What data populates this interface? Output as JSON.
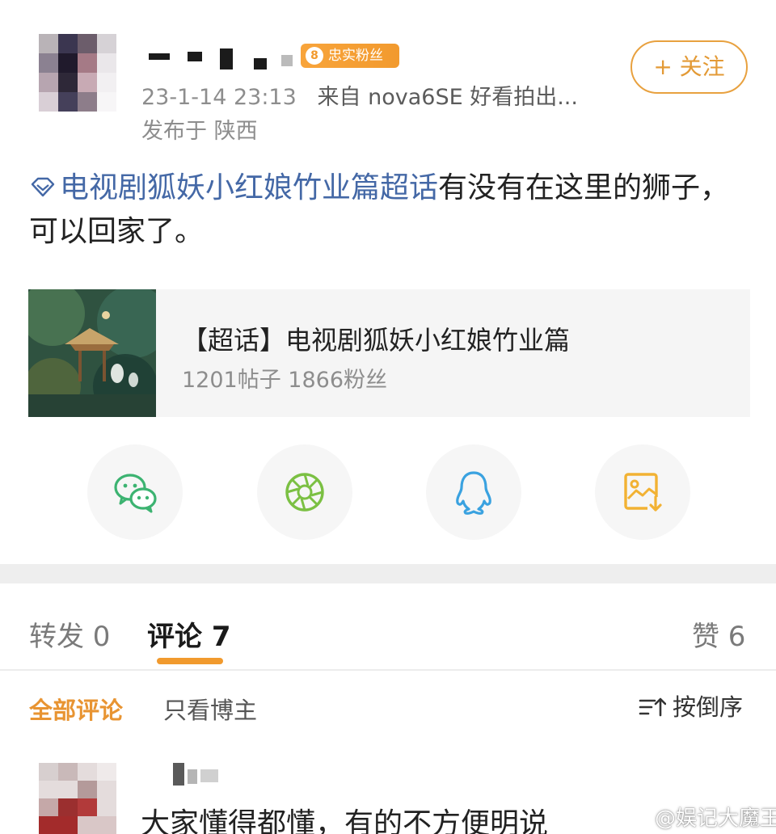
{
  "post": {
    "fan_badge": {
      "level": "8",
      "label": "忠实粉丝"
    },
    "timestamp": "23-1-14 23:13",
    "source": "来自 nova6SE 好看拍出...",
    "location": "发布于 陕西",
    "follow_label": "+ 关注",
    "topic_link": "电视剧狐妖小红娘竹业篇超话",
    "body_text": "有没有在这里的狮子，可以回家了。"
  },
  "topic_card": {
    "title": "【超话】电视剧狐妖小红娘竹业篇",
    "stats": "1201帖子 1866粉丝"
  },
  "share_icons": [
    "wechat-icon",
    "moments-icon",
    "qq-icon",
    "save-image-icon"
  ],
  "tabs": {
    "repost": "转发 0",
    "comments": "评论 7",
    "likes": "赞 6"
  },
  "filters": {
    "all": "全部评论",
    "author_only": "只看博主",
    "sort": "按倒序"
  },
  "comment": {
    "text": "大家懂得都懂，有的不方便明说"
  },
  "watermark": "@娱记大魔王",
  "colors": {
    "accent_orange": "#f19a2e",
    "topic_blue": "#4468a6",
    "wechat_green": "#3cb371",
    "moments_green": "#7bc043",
    "qq_blue": "#3aa2e0",
    "save_orange": "#f2b233"
  }
}
